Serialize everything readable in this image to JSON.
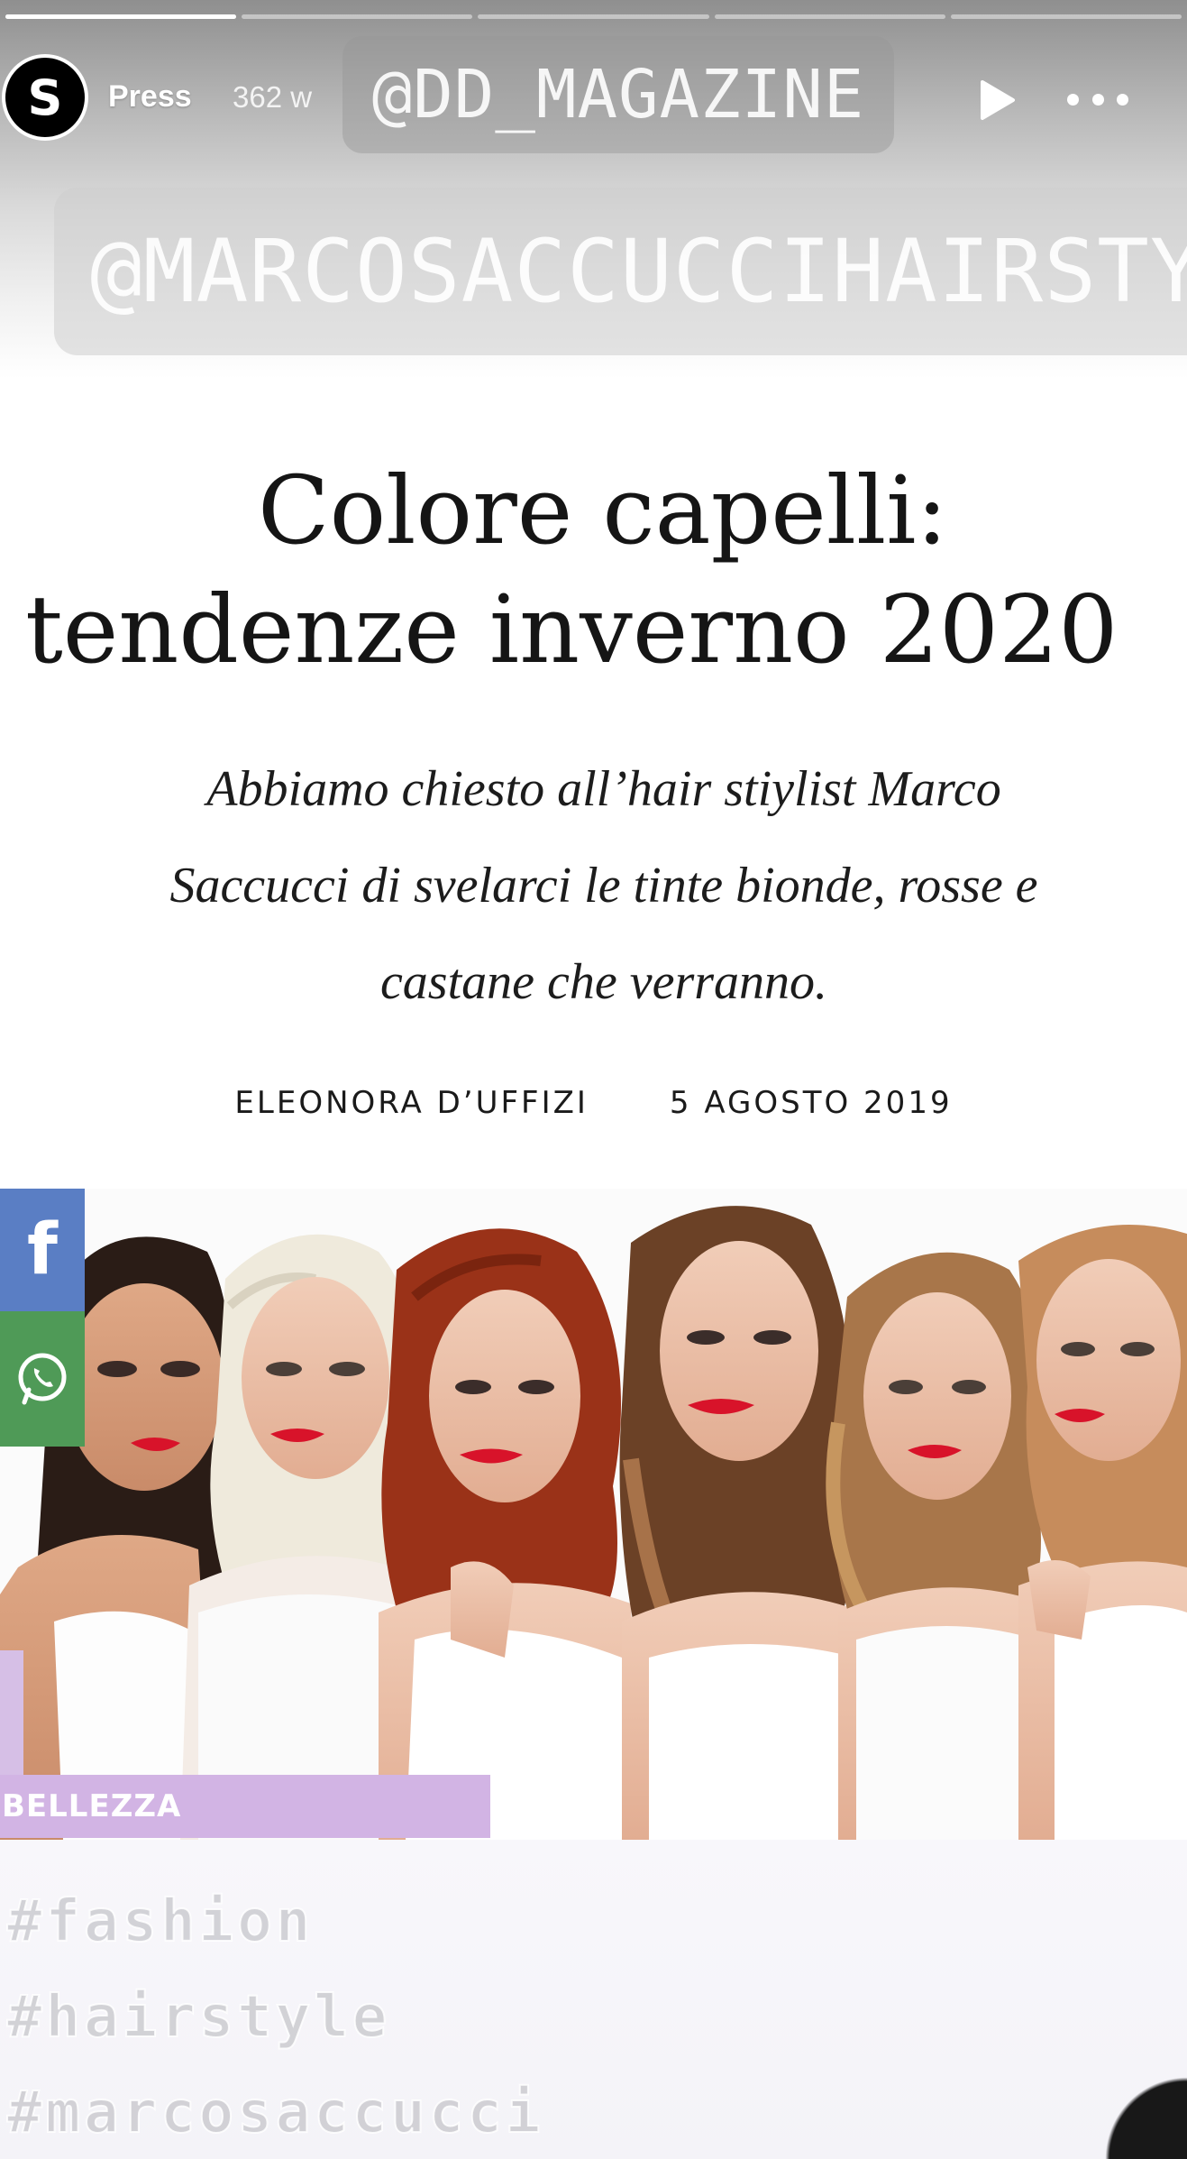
{
  "story": {
    "progress_segments": 5,
    "progress_done": 1,
    "username": "Press",
    "time_ago": "362 w",
    "avatar_letter": "S"
  },
  "stickers": {
    "mention_1": "@DD_MAGAZINE",
    "mention_2": "@MARCOSACCUCCIHAIRSTYLE"
  },
  "article": {
    "title_line1": "Colore capelli:",
    "title_line2": "tendenze inverno 2020",
    "subtitle_line1": "Abbiamo chiesto all’hair stiylist Marco",
    "subtitle_line2": "Saccucci di svelarci le tinte bionde, rosse e",
    "subtitle_line3": "castane che verranno.",
    "author": "ELEONORA D’UFFIZI",
    "date": "5 AGOSTO 2019",
    "category": "BELLEZZA"
  },
  "share": {
    "facebook_glyph": "f"
  },
  "hashtags": [
    "#fashion",
    "#hairstyle",
    "#marcosaccucci"
  ],
  "colors": {
    "facebook": "#5a7ec4",
    "whatsapp": "#4f9a57",
    "category": "#d2b4e4"
  }
}
